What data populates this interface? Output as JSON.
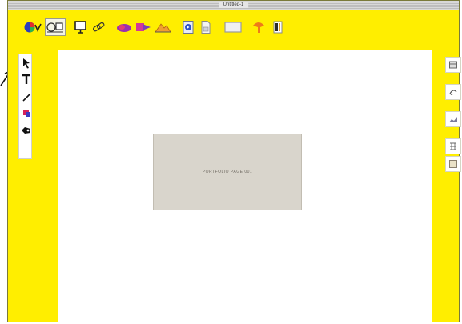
{
  "window": {
    "title": "Untitled-1"
  },
  "canvas": {
    "placeholder_text": "PORTFOLIO PAGE 001"
  },
  "top_toolbar": [
    {
      "id": "color",
      "icon": "color-palette-icon"
    },
    {
      "id": "object-mode",
      "icon": "object-mode-icon"
    },
    {
      "id": "monitor",
      "icon": "monitor-icon"
    },
    {
      "id": "link",
      "icon": "link-icon"
    },
    {
      "id": "shape-a",
      "icon": "shape-tool-icon"
    },
    {
      "id": "shape-b",
      "icon": "arrow-shape-icon"
    },
    {
      "id": "mountain",
      "icon": "landscape-icon"
    },
    {
      "id": "forward",
      "icon": "forward-page-icon"
    },
    {
      "id": "document",
      "icon": "document-icon"
    },
    {
      "id": "frame",
      "icon": "frame-icon"
    },
    {
      "id": "hint",
      "icon": "lightbulb-icon"
    },
    {
      "id": "info",
      "icon": "info-icon"
    }
  ],
  "left_tools": [
    {
      "id": "select",
      "icon": "arrow-cursor-icon"
    },
    {
      "id": "text",
      "icon": "text-tool-icon"
    },
    {
      "id": "line",
      "icon": "line-tool-icon"
    },
    {
      "id": "fill",
      "icon": "fill-shape-icon"
    },
    {
      "id": "hand",
      "icon": "pan-hand-icon"
    }
  ],
  "right_tools": [
    {
      "id": "layout",
      "icon": "layout-icon"
    },
    {
      "id": "connect",
      "icon": "connector-icon"
    },
    {
      "id": "chart",
      "icon": "chart-icon"
    },
    {
      "id": "grid",
      "icon": "grid-icon"
    },
    {
      "id": "image",
      "icon": "image-icon"
    }
  ]
}
